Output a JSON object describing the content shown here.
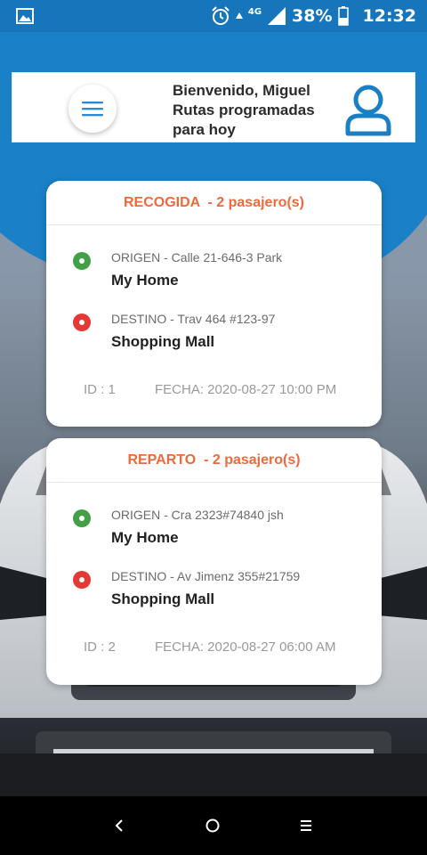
{
  "status_bar": {
    "network": "4G",
    "battery": "38%",
    "time": "12:32",
    "left_icon": "image-icon",
    "icons": [
      "alarm-icon",
      "signal-icon",
      "battery-icon"
    ]
  },
  "header": {
    "greeting": "Bienvenido, Miguel",
    "subtitle_line1": "Rutas programadas",
    "subtitle_line2": "para hoy",
    "menu_icon": "hamburger-icon",
    "user_icon": "user-icon"
  },
  "routes": [
    {
      "title": "RECOGIDA  - 2 pasajero(s)",
      "origin_label": "ORIGEN - Calle 21-646-3 Park",
      "origin_place": "My Home",
      "destination_label": "DESTINO - Trav 464 #123-97",
      "destination_place": "Shopping Mall",
      "id_text": "ID : 1",
      "date_text": "FECHA: 2020-08-27 10:00 PM"
    },
    {
      "title": "REPARTO  - 2 pasajero(s)",
      "origin_label": "ORIGEN - Cra 2323#74840 jsh",
      "origin_place": "My Home",
      "destination_label": "DESTINO - Av Jimenz 355#21759",
      "destination_place": "Shopping Mall",
      "id_text": "ID : 2",
      "date_text": "FECHA: 2020-08-27 06:00 AM"
    }
  ],
  "colors": {
    "primary": "#1675bb",
    "accent": "#ee6a3a",
    "origin": "#43a047",
    "destination": "#e53935"
  },
  "nav_bar": {
    "icons": [
      "back-icon",
      "home-icon",
      "recents-icon"
    ]
  }
}
